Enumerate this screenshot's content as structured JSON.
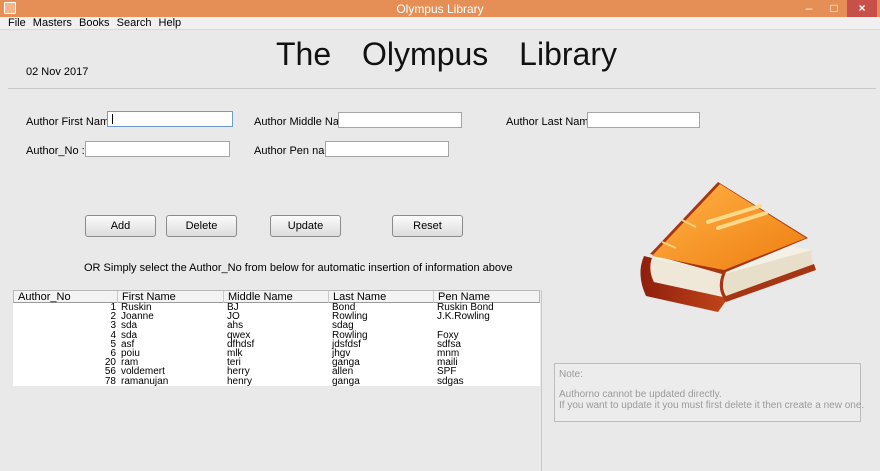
{
  "window": {
    "title": "Olympus Library"
  },
  "menu": [
    "File",
    "Masters",
    "Books",
    "Search",
    "Help"
  ],
  "header": {
    "date": "02 Nov 2017",
    "title": "The Olympus Library"
  },
  "form": {
    "first_name_label": "Author First  Name:",
    "middle_name_label": "Author Middle Name :",
    "last_name_label": "Author Last Name :",
    "author_no_label": "Author_No  :",
    "pen_name_label": "Author Pen name :",
    "first_name_value": "",
    "middle_name_value": "",
    "last_name_value": "",
    "author_no_value": "",
    "pen_name_value": ""
  },
  "buttons": {
    "add": "Add",
    "delete": "Delete",
    "update": "Update",
    "reset": "Reset"
  },
  "hint": "OR Simply select the Author_No from below for automatic insertion of information above",
  "table": {
    "columns": [
      "Author_No",
      "First Name",
      "Middle Name",
      "Last Name",
      "Pen Name"
    ],
    "rows": [
      [
        "1",
        "Ruskin",
        "BJ",
        "Bond",
        "Ruskin Bond"
      ],
      [
        "2",
        "Joanne",
        "JO",
        "Rowling",
        "J.K.Rowling"
      ],
      [
        "3",
        "sda",
        "ahs",
        "sdag",
        ""
      ],
      [
        "4",
        "sda",
        "qwex",
        "Rowling",
        "Foxy"
      ],
      [
        "5",
        "asf",
        "dfhdsf",
        "jdsfdsf",
        "sdfsa"
      ],
      [
        "6",
        "poiu",
        "mlk",
        "jhgv",
        "mnm"
      ],
      [
        "20",
        "ram",
        "teri",
        "ganga",
        "maili"
      ],
      [
        "56",
        "voldemert",
        "herry",
        "allen",
        "SPF"
      ],
      [
        "78",
        "ramanujan",
        "henry",
        "ganga",
        "sdgas"
      ]
    ]
  },
  "note": {
    "title": "Note:",
    "line1": "Authorno cannot be updated directly.",
    "line2": "If you want to update it you must first delete it then create a new one."
  },
  "colors": {
    "titlebar": "#e58f57",
    "close": "#c7504a",
    "book_cover": "#f08a1c"
  },
  "icons": {
    "book": "book-illustration"
  }
}
